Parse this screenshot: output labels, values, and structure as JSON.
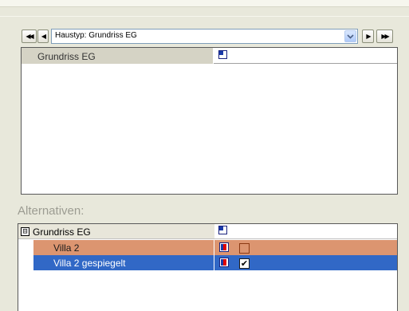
{
  "navigator": {
    "first_glyph": "◀◀",
    "prev_glyph": "◀",
    "next_glyph": "▶",
    "last_glyph": "▶▶",
    "selection": "Haustyp: Grundriss EG",
    "dropdown_glyph": "⌄"
  },
  "top_grid": {
    "rows": [
      {
        "name": "Grundriss EG",
        "icon": "floorplan-icon"
      }
    ]
  },
  "alternatives": {
    "label": "Alternativen:",
    "group": {
      "expander": "⊟",
      "name": "Grundriss EG",
      "icon": "floorplan-icon"
    },
    "items": [
      {
        "name": "Villa 2",
        "icon": "flag-icon",
        "checked": false,
        "check_glyph": ""
      },
      {
        "name": "Villa 2 gespiegelt",
        "icon": "flag-icon",
        "checked": true,
        "check_glyph": "✔"
      }
    ]
  },
  "colors": {
    "panel": "#e8e8db",
    "row_highlight": "#dc9570",
    "row_selected": "#3168c6",
    "label_muted": "#9c9c92"
  }
}
